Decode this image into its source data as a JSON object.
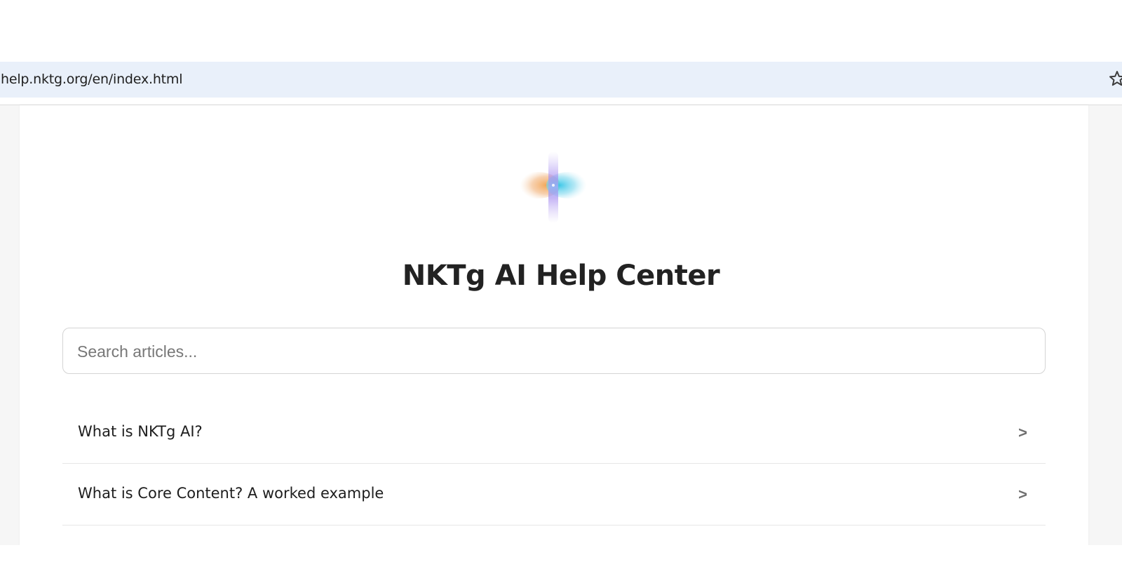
{
  "browser": {
    "url": "help.nktg.org/en/index.html",
    "bookmark_icon": "star-outline-icon"
  },
  "page": {
    "logo_icon": "nktg-logo-icon",
    "title": "NKTg AI Help Center",
    "search": {
      "placeholder": "Search articles...",
      "value": ""
    },
    "articles": [
      {
        "label": "What is NKTg AI?",
        "chevron": ">"
      },
      {
        "label": "What is Core Content? A worked example",
        "chevron": ">"
      }
    ]
  },
  "colors": {
    "address_bar_bg": "#e9f0fa",
    "page_bg": "#f6f6f6",
    "card_bg": "#ffffff",
    "title_text": "#222222",
    "chevron": "#6f6f6f"
  }
}
